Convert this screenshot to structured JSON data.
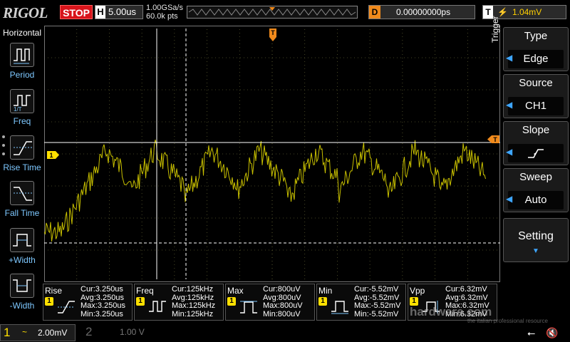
{
  "topbar": {
    "logo": "RIGOL",
    "run_state": "STOP",
    "h_label": "H",
    "timebase": "5.00us",
    "sample_rate": "1.00GSa/s",
    "memory_depth": "60.0k pts",
    "trigger_pos_marker": "T",
    "delay_label": "D",
    "delay_value": "0.00000000ps",
    "trigger_label": "T",
    "trigger_slope_icon": "rising-edge-icon",
    "trigger_level": "1.04mV"
  },
  "left_panel": {
    "title": "Horizontal",
    "items": [
      {
        "label": "Period",
        "icon": "period-icon"
      },
      {
        "label": "Freq",
        "icon": "frequency-icon"
      },
      {
        "label": "Rise Time",
        "icon": "rise-time-icon"
      },
      {
        "label": "Fall Time",
        "icon": "fall-time-icon"
      },
      {
        "label": "+Width",
        "icon": "positive-width-icon"
      },
      {
        "label": "-Width",
        "icon": "negative-width-icon"
      }
    ]
  },
  "right_panel": {
    "section_label": "Trigger",
    "menus": [
      {
        "title": "Type",
        "value": "Edge"
      },
      {
        "title": "Source",
        "value": "CH1"
      },
      {
        "title": "Slope",
        "value_icon": "rising-edge-icon"
      },
      {
        "title": "Sweep",
        "value": "Auto"
      }
    ],
    "setting_label": "Setting"
  },
  "grid": {
    "ch1_marker": "1",
    "trigger_level_marker": "T",
    "trace_color": "#c8c000",
    "grid_color": "#5a5a30"
  },
  "measurements": [
    {
      "name": "Rise",
      "icon": "rise-time-icon",
      "channel": "1",
      "cur": "Cur:3.250us",
      "avg": "Avg:3.250us",
      "max": "Max:3.250us",
      "min": "Min:3.250us"
    },
    {
      "name": "Freq",
      "icon": "frequency-icon",
      "channel": "1",
      "cur": "Cur:125kHz",
      "avg": "Avg:125kHz",
      "max": "Max:125kHz",
      "min": "Min:125kHz"
    },
    {
      "name": "Max",
      "icon": "max-voltage-icon",
      "channel": "1",
      "cur": "Cur:800uV",
      "avg": "Avg:800uV",
      "max": "Max:800uV",
      "min": "Min:800uV"
    },
    {
      "name": "Min",
      "icon": "min-voltage-icon",
      "channel": "1",
      "cur": "Cur:-5.52mV",
      "avg": "Avg:-5.52mV",
      "max": "Max:-5.52mV",
      "min": "Min:-5.52mV"
    },
    {
      "name": "Vpp",
      "icon": "peak-to-peak-icon",
      "channel": "1",
      "cur": "Cur:6.32mV",
      "avg": "Avg:6.32mV",
      "max": "Max:6.32mV",
      "min": "Min:6.32mV"
    }
  ],
  "bottombar": {
    "ch1_number": "1",
    "ch1_coupling": "~",
    "ch1_scale": "2.00mV",
    "ch2_number": "2",
    "ch2_scale": "1.00 V",
    "usb_icon": "usb-icon",
    "sound_icon": "speaker-muted-icon"
  },
  "watermark": {
    "text": "hardware.com",
    "subtitle": "the italian professional resource"
  },
  "colors": {
    "ch1": "#ffe000",
    "stop": "#d8141b",
    "accent": "#3ea6ff",
    "delay": "#f08a1c"
  }
}
